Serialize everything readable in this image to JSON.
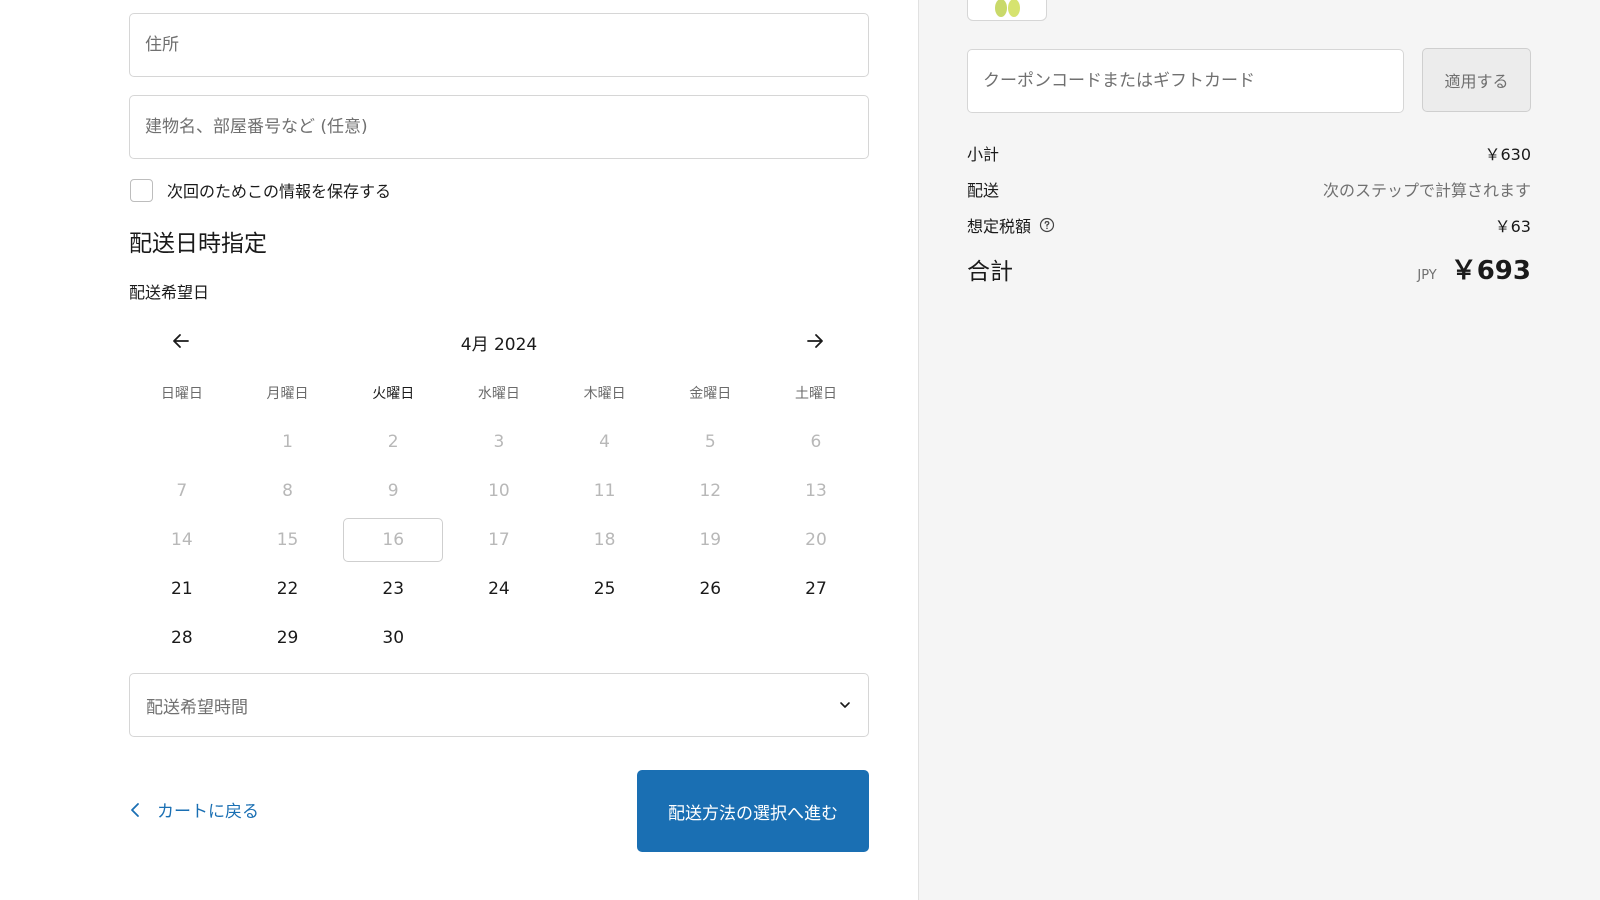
{
  "address": {
    "address_placeholder": "住所",
    "building_placeholder": "建物名、部屋番号など (任意)",
    "save_info_label": "次回のためこの情報を保存する"
  },
  "delivery": {
    "section_title": "配送日時指定",
    "date_label": "配送希望日",
    "calendar": {
      "month_label": "4月 2024",
      "weekdays": [
        "日曜日",
        "月曜日",
        "火曜日",
        "水曜日",
        "木曜日",
        "金曜日",
        "土曜日"
      ],
      "weeks": [
        [
          "",
          "1",
          "2",
          "3",
          "4",
          "5",
          "6"
        ],
        [
          "7",
          "8",
          "9",
          "10",
          "11",
          "12",
          "13"
        ],
        [
          "14",
          "15",
          "16",
          "17",
          "18",
          "19",
          "20"
        ],
        [
          "21",
          "22",
          "23",
          "24",
          "25",
          "26",
          "27"
        ],
        [
          "28",
          "29",
          "30",
          "",
          "",
          "",
          ""
        ]
      ],
      "today": "16",
      "first_available": 21
    },
    "time_placeholder": "配送希望時間"
  },
  "actions": {
    "back_label": "カートに戻る",
    "continue_label": "配送方法の選択へ進む"
  },
  "summary": {
    "coupon_placeholder": "クーポンコードまたはギフトカード",
    "apply_label": "適用する",
    "subtotal_label": "小計",
    "subtotal_value": "￥630",
    "shipping_label": "配送",
    "shipping_value": "次のステップで計算されます",
    "tax_label": "想定税額",
    "tax_value": "￥63",
    "total_label": "合計",
    "currency": "JPY",
    "total_value": "￥693"
  },
  "colors": {
    "accent": "#1a6fb3",
    "sidebar_bg": "#f5f5f5"
  }
}
